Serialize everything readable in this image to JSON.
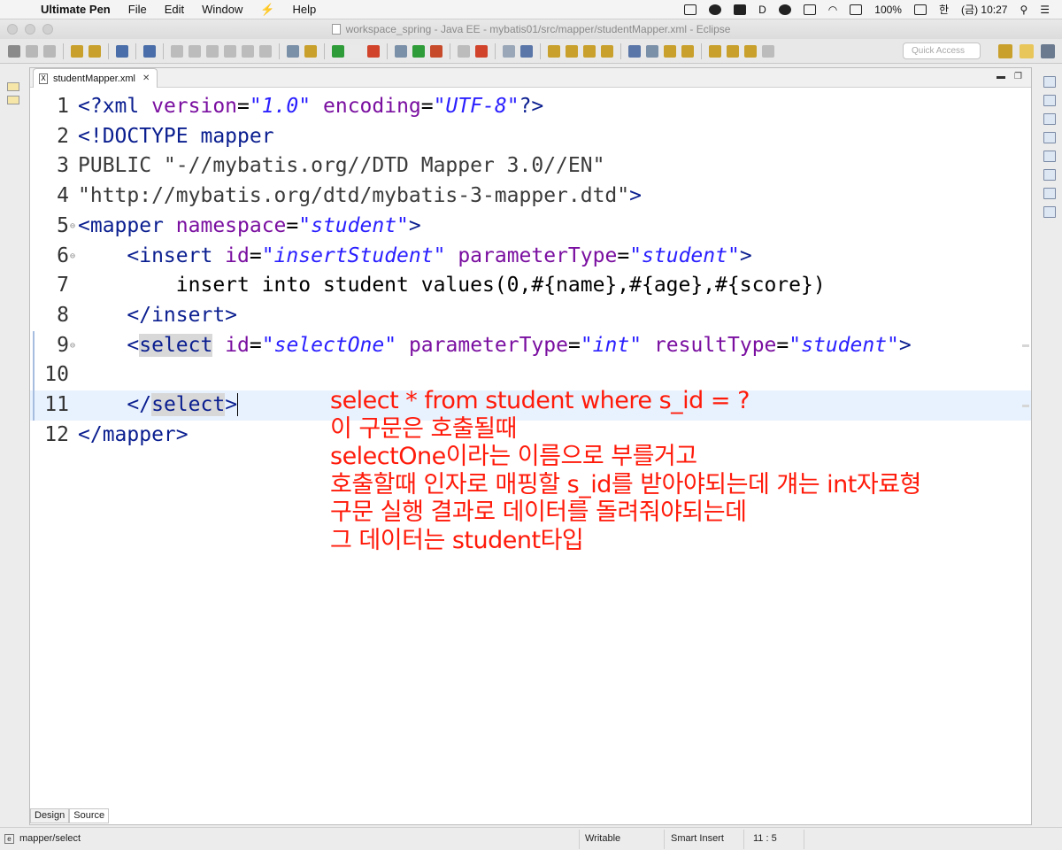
{
  "menubar": {
    "app": "Ultimate Pen",
    "items": [
      "File",
      "Edit",
      "Window",
      "Help"
    ],
    "battery": "100%",
    "lang": "한",
    "clock": "(금) 10:27"
  },
  "window": {
    "title": "workspace_spring - Java EE - mybatis01/src/mapper/studentMapper.xml - Eclipse"
  },
  "toolbar": {
    "quick_access_placeholder": "Quick Access"
  },
  "editor": {
    "tab_label": "studentMapper.xml",
    "lines": [
      {
        "num": "1",
        "segments": [
          [
            "tag",
            "<?xml "
          ],
          [
            "attr",
            "version"
          ],
          [
            "content",
            "="
          ],
          [
            "val",
            "\"1.0\""
          ],
          [
            "content",
            " "
          ],
          [
            "attr",
            "encoding"
          ],
          [
            "content",
            "="
          ],
          [
            "val",
            "\"UTF-8\""
          ],
          [
            "tag",
            "?>"
          ]
        ]
      },
      {
        "num": "2",
        "segments": [
          [
            "tag",
            "<!DOCTYPE mapper"
          ]
        ]
      },
      {
        "num": "3",
        "segments": [
          [
            "dt",
            "PUBLIC \"-//mybatis.org//DTD Mapper 3.0//EN\""
          ]
        ]
      },
      {
        "num": "4",
        "segments": [
          [
            "dt",
            "\"http://mybatis.org/dtd/mybatis-3-mapper.dtd\""
          ],
          [
            "tag",
            ">"
          ]
        ]
      },
      {
        "num": "5",
        "fold": true,
        "segments": [
          [
            "tag",
            "<mapper "
          ],
          [
            "attr",
            "namespace"
          ],
          [
            "content",
            "="
          ],
          [
            "val",
            "\"student\""
          ],
          [
            "tag",
            ">"
          ]
        ]
      },
      {
        "num": "6",
        "fold": true,
        "segments": [
          [
            "content",
            "    "
          ],
          [
            "tag",
            "<insert "
          ],
          [
            "attr",
            "id"
          ],
          [
            "content",
            "="
          ],
          [
            "val",
            "\"insertStudent\""
          ],
          [
            "content",
            " "
          ],
          [
            "attr",
            "parameterType"
          ],
          [
            "content",
            "="
          ],
          [
            "val",
            "\"student\""
          ],
          [
            "tag",
            ">"
          ]
        ]
      },
      {
        "num": "7",
        "segments": [
          [
            "content",
            "        insert into student values(0,#{name},#{age},#{score})"
          ]
        ]
      },
      {
        "num": "8",
        "segments": [
          [
            "content",
            "    "
          ],
          [
            "tag",
            "</insert>"
          ]
        ]
      },
      {
        "num": "9",
        "fold": true,
        "segments": [
          [
            "content",
            "    "
          ],
          [
            "tag",
            "<"
          ],
          [
            "taghl",
            "select"
          ],
          [
            "content",
            " "
          ],
          [
            "attr",
            "id"
          ],
          [
            "content",
            "="
          ],
          [
            "val",
            "\"selectOne\""
          ],
          [
            "content",
            " "
          ],
          [
            "attr",
            "parameterType"
          ],
          [
            "content",
            "="
          ],
          [
            "val",
            "\"int\""
          ],
          [
            "content",
            " "
          ],
          [
            "attr",
            "resultType"
          ],
          [
            "content",
            "="
          ],
          [
            "val",
            "\"student\""
          ],
          [
            "tag",
            ">"
          ]
        ]
      },
      {
        "num": "10",
        "segments": []
      },
      {
        "num": "11",
        "current": true,
        "segments": [
          [
            "content",
            "    "
          ],
          [
            "tag",
            "</"
          ],
          [
            "taghl",
            "select"
          ],
          [
            "tagcaret",
            ">"
          ]
        ]
      },
      {
        "num": "12",
        "segments": [
          [
            "tag",
            "</mapper>"
          ]
        ]
      }
    ],
    "annotation": [
      "select * from student where s_id = ?",
      "이 구문은 호출될때",
      "selectOne이라는 이름으로 부를거고",
      "호출할때 인자로 매핑할 s_id를 받아야되는데 걔는 int자료형",
      "구문 실행 결과로 데이터를 돌려줘야되는데",
      "그 데이터는 student타입"
    ],
    "bottom_tabs": [
      "Design",
      "Source"
    ]
  },
  "status": {
    "path": "mapper/select",
    "mode": "Writable",
    "insert": "Smart Insert",
    "position": "11 : 5"
  },
  "colors": {
    "annotation": "#ff1a0a",
    "tag": "#0a1e8f",
    "attribute": "#7a0fa0",
    "value": "#2a1fff",
    "current_line": "#e8f2fe"
  }
}
